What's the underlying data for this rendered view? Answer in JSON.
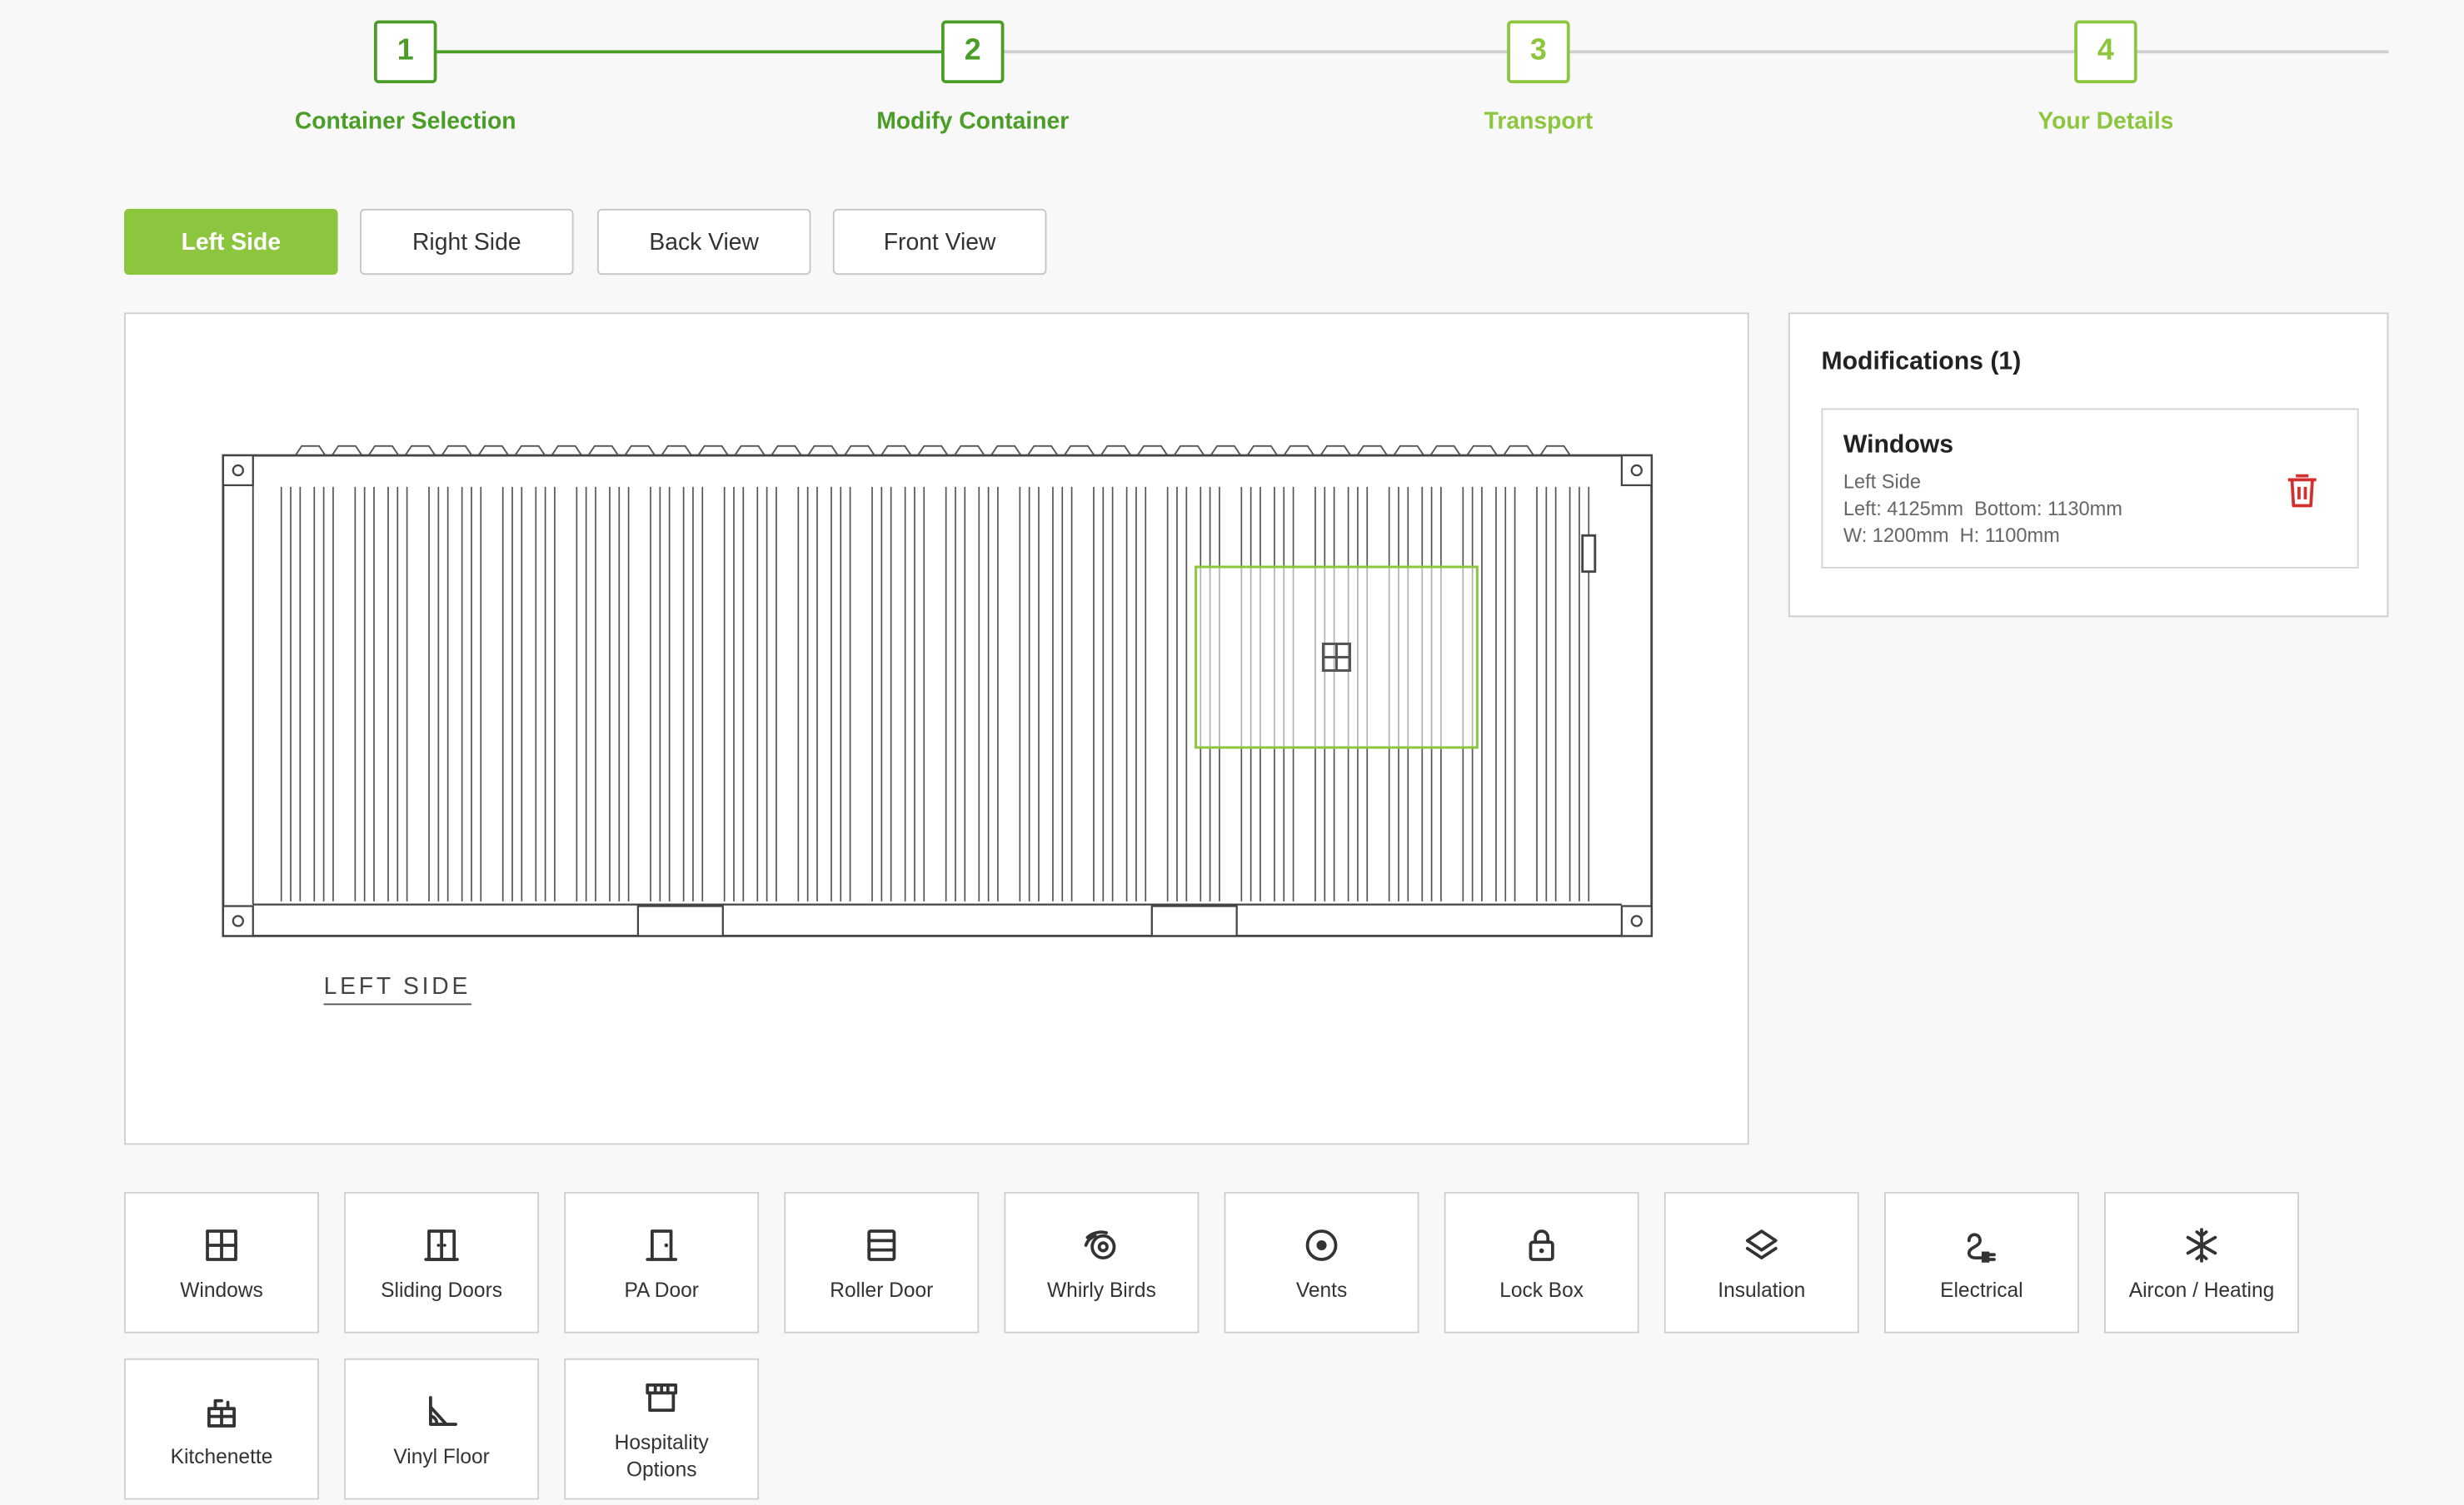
{
  "stepper": {
    "steps": [
      {
        "number": "1",
        "label": "Container Selection",
        "state": "done"
      },
      {
        "number": "2",
        "label": "Modify Container",
        "state": "current"
      },
      {
        "number": "3",
        "label": "Transport",
        "state": "upcoming"
      },
      {
        "number": "4",
        "label": "Your Details",
        "state": "upcoming"
      }
    ]
  },
  "views": {
    "tabs": [
      "Left Side",
      "Right Side",
      "Back View",
      "Front View"
    ],
    "active": "Left Side"
  },
  "canvas": {
    "side_label": "LEFT SIDE",
    "window_icon": "window-icon"
  },
  "modifications": {
    "title": "Modifications (1)",
    "items": [
      {
        "name": "Windows",
        "side": "Left Side",
        "position": "Left: 4125mm  Bottom: 1130mm",
        "size": "W: 1200mm  H: 1100mm",
        "delete_icon": "trash-icon"
      }
    ]
  },
  "features": [
    {
      "label": "Windows",
      "icon": "window-icon"
    },
    {
      "label": "Sliding Doors",
      "icon": "sliding-door-icon"
    },
    {
      "label": "PA Door",
      "icon": "door-icon"
    },
    {
      "label": "Roller Door",
      "icon": "roller-door-icon"
    },
    {
      "label": "Whirly Birds",
      "icon": "whirly-bird-icon"
    },
    {
      "label": "Vents",
      "icon": "vent-icon"
    },
    {
      "label": "Lock Box",
      "icon": "lock-icon"
    },
    {
      "label": "Insulation",
      "icon": "layers-icon"
    },
    {
      "label": "Electrical",
      "icon": "plug-icon"
    },
    {
      "label": "Aircon / Heating",
      "icon": "snowflake-icon"
    },
    {
      "label": "Kitchenette",
      "icon": "kitchen-icon"
    },
    {
      "label": "Vinyl Floor",
      "icon": "floor-icon"
    },
    {
      "label": "Hospitality Options",
      "icon": "storefront-icon"
    }
  ],
  "colors": {
    "accent": "#8cc63f",
    "accent_dark": "#4a9d27",
    "delete": "#d32f2f"
  }
}
